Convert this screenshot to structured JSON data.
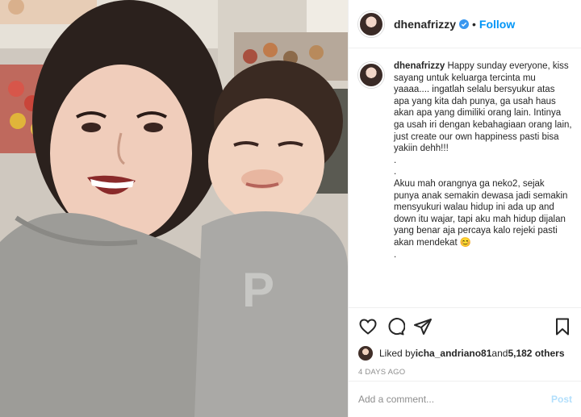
{
  "post": {
    "username": "dhenafrizzy",
    "verified_icon": "verified-badge-icon",
    "follow_separator": "•",
    "follow_label": "Follow"
  },
  "caption": {
    "username": "dhenafrizzy",
    "text": " Happy sunday everyone, kiss sayang untuk keluarga tercinta mu yaaaa.... ingatlah selalu bersyukur atas apa yang kita dah punya, ga usah haus akan apa yang dimiliki orang lain. Intinya ga usah iri dengan kebahagiaan orang lain, just create our own happiness pasti bisa yakiin dehh!!!\n.\n.\nAkuu mah orangnya ga neko2, sejak punya anak semakin dewasa jadi semakin mensyukuri walau hidup ini ada up and down itu wajar, tapi aku mah hidup dijalan yang benar aja percaya kalo rejeki pasti akan mendekat 😊\n."
  },
  "actions": {
    "like_icon": "heart-icon",
    "comment_icon": "comment-icon",
    "share_icon": "share-icon",
    "save_icon": "bookmark-icon"
  },
  "likes": {
    "prefix": "Liked by ",
    "user": "icha_andriano81",
    "middle": " and ",
    "count": "5,182 others"
  },
  "timestamp": "4 DAYS AGO",
  "comment": {
    "placeholder": "Add a comment...",
    "post_label": "Post"
  },
  "colors": {
    "accent": "#0095f6",
    "post_disabled": "#b2dffc",
    "muted": "#8e8e8e",
    "text": "#262626"
  }
}
